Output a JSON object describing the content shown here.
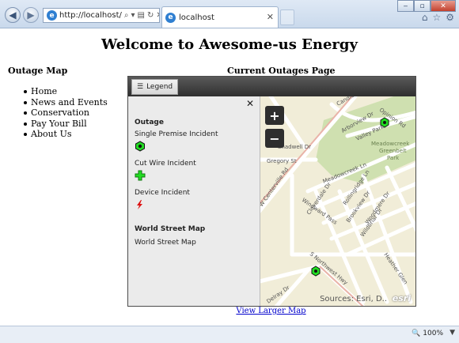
{
  "browser": {
    "address": "http://localhost/",
    "tab_title": "localhost",
    "zoom": "100%"
  },
  "page": {
    "title": "Welcome to Awesome-us Energy",
    "sidebar_heading": "Outage Map",
    "nav_items": [
      "Home",
      "News and Events",
      "Conservation",
      "Pay Your Bill",
      "About Us"
    ],
    "main_heading": "Current Outages Page",
    "view_larger_link": "View Larger Map"
  },
  "map_widget": {
    "legend_button": "Legend",
    "legend": {
      "layer1_title": "Outage",
      "item1": "Single Premise Incident",
      "item2": "Cut Wire Incident",
      "item3": "Device Incident",
      "layer2_title": "World Street Map",
      "layer2_item": "World Street Map"
    },
    "zoom_in": "+",
    "zoom_out": "−",
    "attribution": "Sources: Esri, D..",
    "logo": "esri",
    "streets": [
      "Candle",
      "Arborview Dr",
      "Opinion Rd",
      "Valley Park",
      "Meadowcreek",
      "Greenbelt",
      "Park",
      "Gregory St",
      "W Centerville Rd",
      "Meadowcreek Ln",
      "Cloverdale Dr",
      "Rollingridge Ln",
      "Windward Pass",
      "Brookview Dr",
      "Woodmere Dr",
      "Wildbriar Dr",
      "Heather Glen",
      "S Northwest Hwy",
      "Delray Dr",
      "Shadwell Dr"
    ]
  },
  "colors": {
    "incident_green": "#22dd22",
    "device_red": "#dd1111",
    "map_road": "#ffffff",
    "map_bg": "#f1edd8",
    "park": "#cfe0b0"
  }
}
